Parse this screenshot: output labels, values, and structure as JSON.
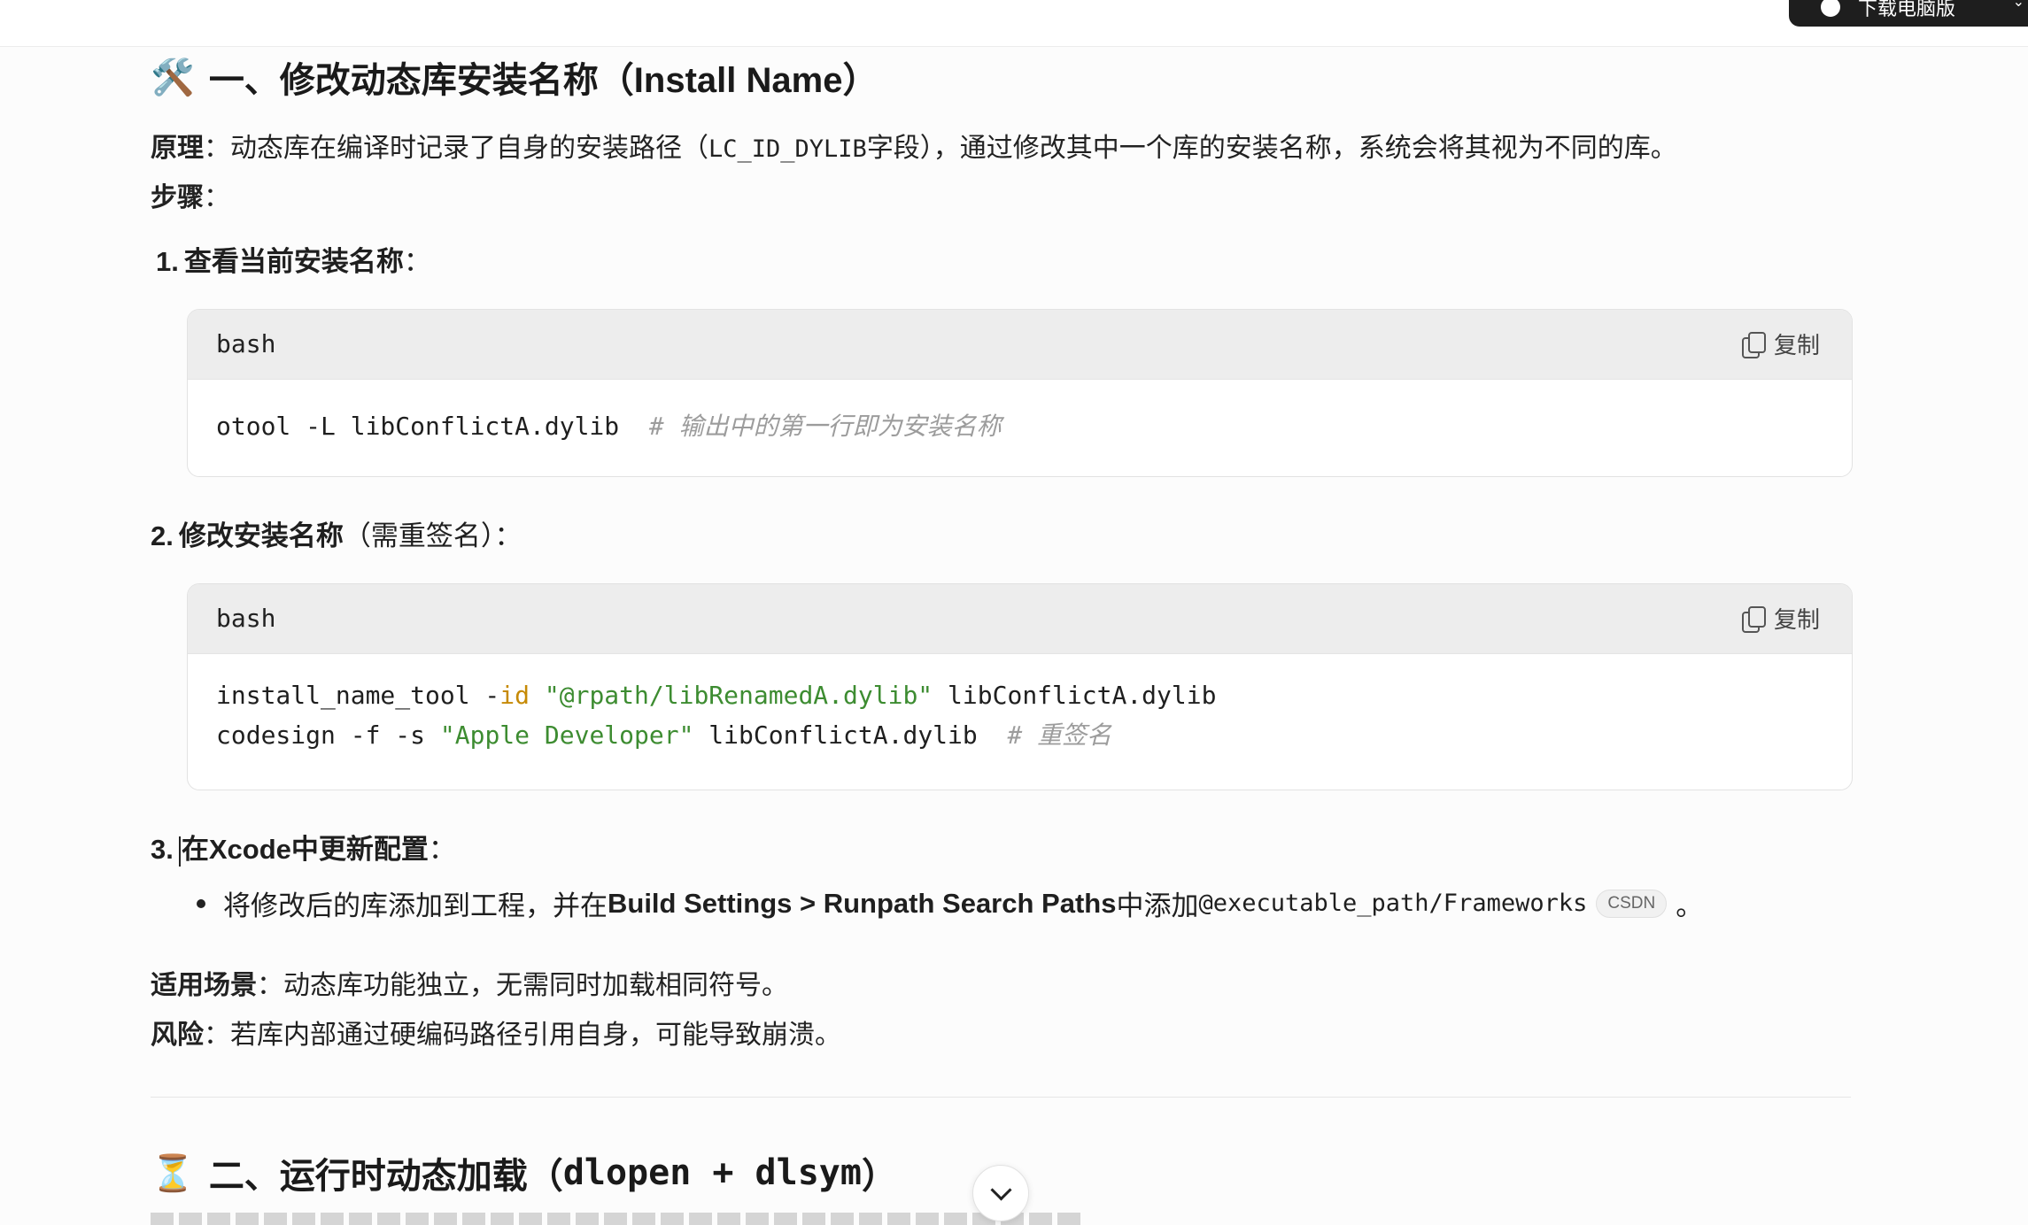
{
  "top": {
    "download_label": "下载电脑版"
  },
  "section1": {
    "emoji": "🛠️",
    "title": "一、修改动态库安装名称（Install Name）",
    "principle_label": "原理",
    "principle_text_a": "：动态库在编译时记录了自身的安装路径（",
    "principle_code": "LC_ID_DYLIB",
    "principle_text_b": "字段），通过修改其中一个库的安装名称，系统会将其视为不同的库。",
    "steps_label": "步骤",
    "steps_colon": "：",
    "step1": {
      "num": "1.",
      "title": "查看当前安装名称",
      "colon": "："
    },
    "code1": {
      "lang": "bash",
      "copy": "复制",
      "line1_code": "otool -L libConflictA.dylib  ",
      "line1_comment": "# 输出中的第一行即为安装名称"
    },
    "step2": {
      "num": "2.",
      "title": "修改安装名称",
      "paren": "（需重签名）："
    },
    "code2": {
      "lang": "bash",
      "copy": "复制",
      "l1_a": "install_name_tool -",
      "l1_kw": "id",
      "l1_b": " ",
      "l1_str": "\"@rpath/libRenamedA.dylib\"",
      "l1_c": " libConflictA.dylib",
      "l2_a": "codesign -f -s ",
      "l2_str": "\"Apple Developer\"",
      "l2_b": " libConflictA.dylib  ",
      "l2_comment": "# 重签名"
    },
    "step3": {
      "num": "3.",
      "title": "在Xcode中更新配置",
      "colon": "："
    },
    "bullet": {
      "text_a": "将修改后的库添加到工程，并在 ",
      "bold": "Build Settings > Runpath Search Paths",
      "text_b": " 中添加",
      "code": "@executable_path/Frameworks",
      "tag": "CSDN",
      "end": "。"
    },
    "scene_label": "适用场景",
    "scene_text": "：动态库功能独立，无需同时加载相同符号。",
    "risk_label": "风险",
    "risk_text": "：若库内部通过硬编码路径引用自身，可能导致崩溃。"
  },
  "section2": {
    "emoji": "⏳",
    "title_a": "二、运行时动态加载（",
    "title_code": "dlopen + dlsym",
    "title_b": "）"
  }
}
